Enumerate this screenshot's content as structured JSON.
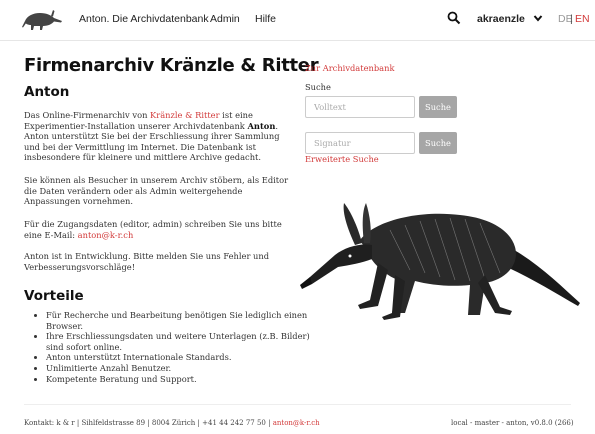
{
  "navbar": {
    "logo_icon": "aardvark-logo-icon",
    "brand": "Anton. Die Archivdatenbank",
    "admin": "Admin",
    "help": "Hilfe",
    "search_icon": "search-icon",
    "user": "akraenzle",
    "user_caret_icon": "chevron-down-icon",
    "lang_de": "DE",
    "lang_sep": "|",
    "lang_en": "EN",
    "active_lang_color": "#d23a3a"
  },
  "main": {
    "title": "Firmenarchiv Kränzle & Ritter",
    "section_anton": "Anton",
    "p1_a": "Das Online-Firmenarchiv von ",
    "p1_link": "Kränzle & Ritter",
    "p1_b": " ist eine Experimentier-Installation unserer Archivdatenbank ",
    "p1_bold": "Anton",
    "p1_c": ". Anton unterstützt Sie bei der Erschliessung ihrer Sammlung und bei der Vermittlung im Internet. Die Datenbank ist insbesondere für kleinere und mittlere Archive gedacht.",
    "p2": "Sie können als Besucher in unserem Archiv stöbern, als Editor die Daten verändern oder als Admin weitergehende Anpassungen vornehmen.",
    "p3_a": "Für die Zugangsdaten (editor, admin) schreiben Sie uns bitte eine E-Mail: ",
    "p3_link": "anton@k-r.ch",
    "p4": "Anton ist in Entwicklung. Bitte melden Sie uns Fehler und Verbesserungsvorschläge!",
    "section_vorteile": "Vorteile",
    "vorteile": [
      "Für Recherche und Bearbeitung benötigen Sie lediglich einen Browser.",
      "Ihre Erschliessungsdaten und weitere Unterlagen (z.B. Bilder) sind sofort online.",
      "Anton unterstützt Internationale Standards.",
      "Unlimitierte Anzahl Benutzer.",
      "Kompetente Beratung und Support."
    ]
  },
  "sidebar": {
    "db_link": "Zur Archivdatenbank",
    "search_label": "Suche",
    "fulltext_placeholder": "Volltext",
    "fulltext_button": "Suche",
    "signature_placeholder": "Signatur",
    "signature_button": "Suche",
    "advanced_link": "Erweiterte Suche",
    "illustration_icon": "aardvark-illustration"
  },
  "footer": {
    "contact_text": "Kontakt: k & r | Sihlfeldstrasse 89 | 8004 Zürich | +41 44 242 77 50 | ",
    "contact_email": "anton@k-r.ch",
    "version": "local - master - anton, v0.8.0 (266)"
  }
}
